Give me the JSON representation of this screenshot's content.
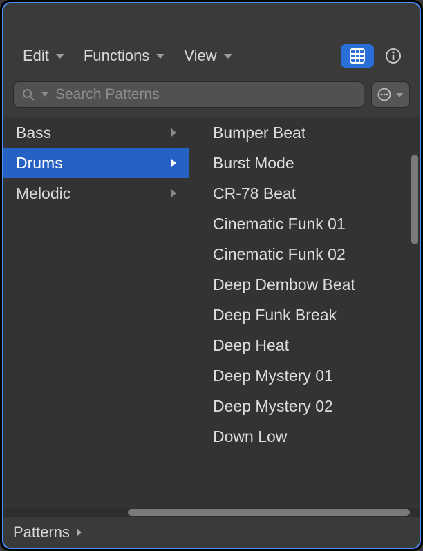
{
  "toolbar": {
    "edit_label": "Edit",
    "functions_label": "Functions",
    "view_label": "View"
  },
  "search": {
    "placeholder": "Search Patterns"
  },
  "categories": [
    {
      "label": "Bass",
      "selected": false
    },
    {
      "label": "Drums",
      "selected": true
    },
    {
      "label": "Melodic",
      "selected": false
    }
  ],
  "patterns": [
    "Bumper Beat",
    "Burst Mode",
    "CR-78 Beat",
    "Cinematic Funk 01",
    "Cinematic Funk 02",
    "Deep Dembow Beat",
    "Deep Funk Break",
    "Deep Heat",
    "Deep Mystery 01",
    "Deep Mystery 02",
    "Down Low"
  ],
  "footer": {
    "breadcrumb": "Patterns"
  }
}
